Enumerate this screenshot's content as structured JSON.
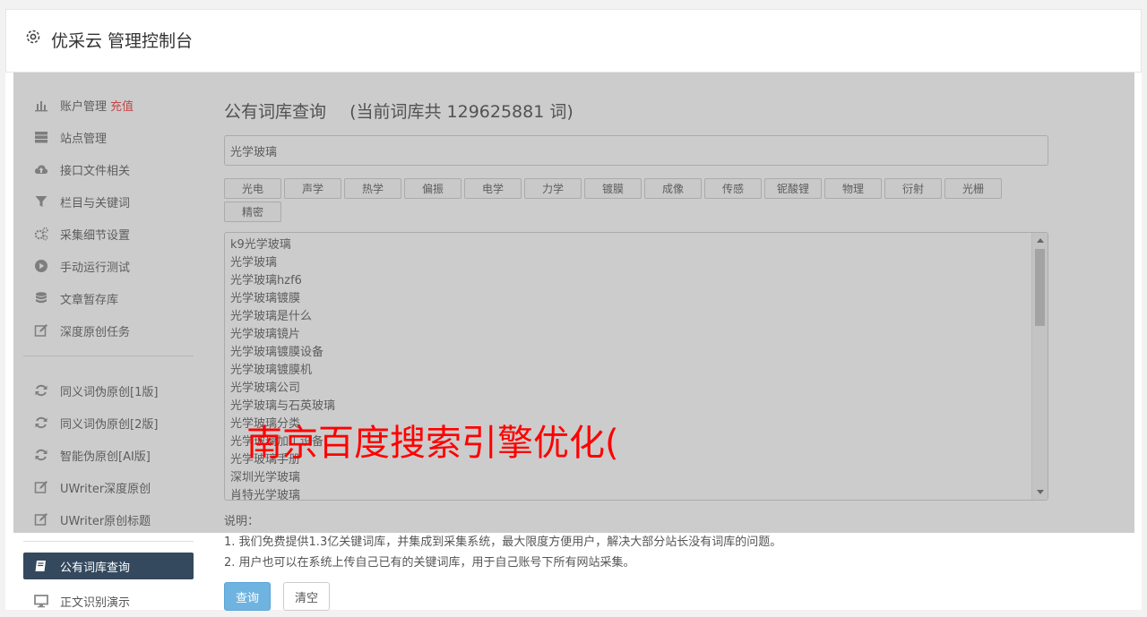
{
  "header": {
    "title": "优采云 管理控制台",
    "icon": "gear-icon"
  },
  "sidebar": {
    "items": [
      {
        "label": "账户管理",
        "badge": "充值",
        "icon": "bar-chart-icon"
      },
      {
        "label": "站点管理",
        "icon": "server-icon"
      },
      {
        "label": "接口文件相关",
        "icon": "cloud-upload-icon"
      },
      {
        "label": "栏目与关键词",
        "icon": "filter-icon"
      },
      {
        "label": "采集细节设置",
        "icon": "cogs-icon"
      },
      {
        "label": "手动运行测试",
        "icon": "play-circle-icon"
      },
      {
        "label": "文章暂存库",
        "icon": "database-icon"
      },
      {
        "label": "深度原创任务",
        "icon": "edit-icon"
      },
      {
        "label": "同义词伪原创[1版]",
        "icon": "refresh-icon"
      },
      {
        "label": "同义词伪原创[2版]",
        "icon": "refresh-icon"
      },
      {
        "label": "智能伪原创[AI版]",
        "icon": "refresh-icon"
      },
      {
        "label": "UWriter深度原创",
        "icon": "edit-icon"
      },
      {
        "label": "UWriter原创标题",
        "icon": "edit-icon"
      },
      {
        "label": "公有词库查询",
        "icon": "book-icon"
      },
      {
        "label": "正文识别演示",
        "icon": "monitor-icon"
      }
    ]
  },
  "main": {
    "title": "公有词库查询",
    "count_text": "(当前词库共 129625881 词)",
    "search_value": "光学玻璃",
    "tags": [
      "光电",
      "声学",
      "热学",
      "偏振",
      "电学",
      "力学",
      "镀膜",
      "成像",
      "传感",
      "铌酸锂",
      "物理",
      "衍射",
      "光栅",
      "精密"
    ],
    "results": [
      "k9光学玻璃",
      "光学玻璃",
      "光学玻璃hzf6",
      "光学玻璃镀膜",
      "光学玻璃是什么",
      "光学玻璃镜片",
      "光学玻璃镀膜设备",
      "光学玻璃镀膜机",
      "光学玻璃公司",
      "光学玻璃与石英玻璃",
      "光学玻璃分类",
      "光学玻璃加工设备",
      "光学玻璃手册",
      "深圳光学玻璃",
      "肖特光学玻璃"
    ],
    "notes": {
      "heading": "说明：",
      "lines": [
        "1. 我们免费提供1.3亿关键词库，并集成到采集系统，最大限度方便用户，解决大部分站长没有词库的问题。",
        "2. 用户也可以在系统上传自己已有的关键词库，用于自己账号下所有网站采集。"
      ]
    },
    "buttons": {
      "query": "查询",
      "clear": "清空"
    }
  },
  "watermark": "南京百度搜索引擎优化(",
  "colors": {
    "active_nav": "#34495e",
    "badge": "#e33333",
    "primary_button": "#6fb3e0",
    "watermark": "#ff0000"
  }
}
